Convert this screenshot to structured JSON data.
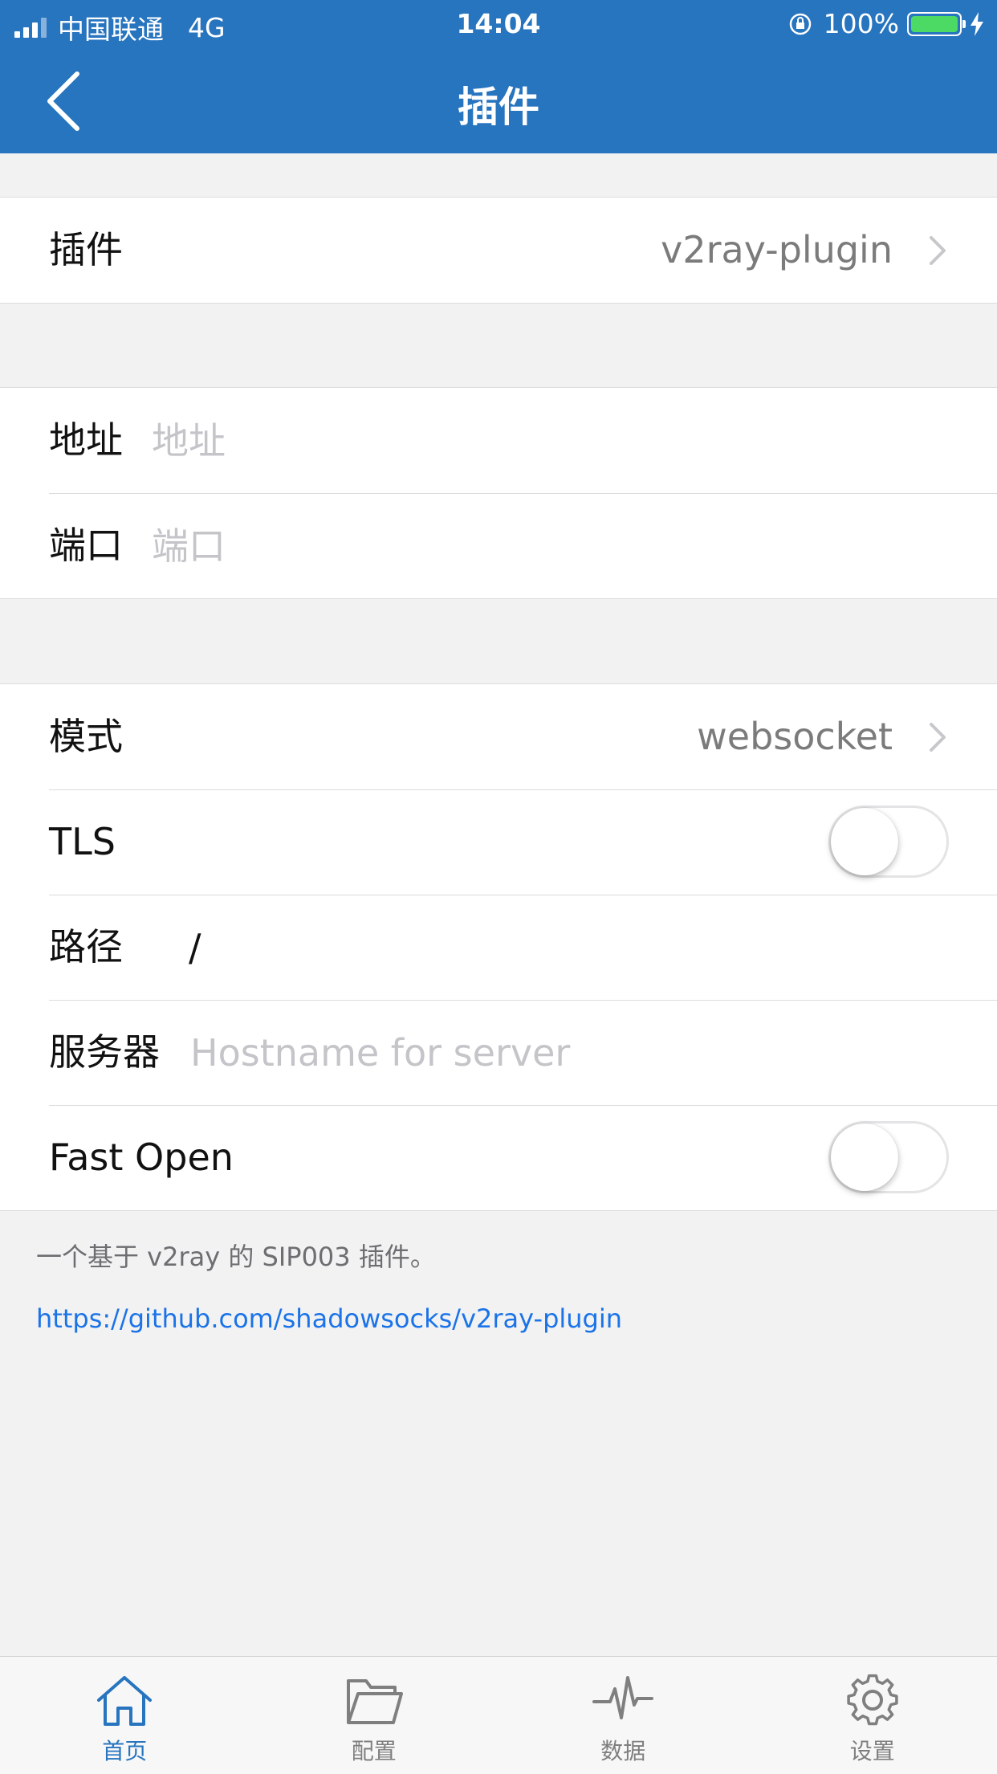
{
  "status_bar": {
    "carrier": "中国联通",
    "network": "4G",
    "time": "14:04",
    "battery": "100%",
    "battery_color": "#4cd964"
  },
  "nav": {
    "title": "插件",
    "back_icon": "chevron-left-icon",
    "bar_color": "#2774bf"
  },
  "plugin_section": {
    "label": "插件",
    "value": "v2ray-plugin"
  },
  "address_section": {
    "address_label": "地址",
    "address_placeholder": "地址",
    "port_label": "端口",
    "port_placeholder": "端口"
  },
  "options_section": {
    "mode_label": "模式",
    "mode_value": "websocket",
    "tls_label": "TLS",
    "tls_on": false,
    "path_label": "路径",
    "path_value": "/",
    "server_label": "服务器",
    "server_placeholder": "Hostname for server",
    "fast_open_label": "Fast Open",
    "fast_open_on": false
  },
  "footer": {
    "description": "一个基于 v2ray 的 SIP003 插件。",
    "link": "https://github.com/shadowsocks/v2ray-plugin"
  },
  "tabbar": {
    "active_color": "#2774bf",
    "tabs": [
      {
        "label": "首页",
        "icon": "home-icon",
        "active": true
      },
      {
        "label": "配置",
        "icon": "folder-icon",
        "active": false
      },
      {
        "label": "数据",
        "icon": "pulse-icon",
        "active": false
      },
      {
        "label": "设置",
        "icon": "gear-icon",
        "active": false
      }
    ]
  }
}
